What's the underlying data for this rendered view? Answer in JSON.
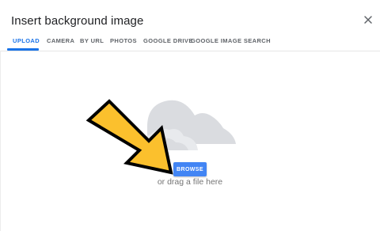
{
  "dialog": {
    "title": "Insert background image",
    "close_icon": "close-icon"
  },
  "tabs": [
    {
      "label": "UPLOAD",
      "active": true
    },
    {
      "label": "CAMERA",
      "active": false
    },
    {
      "label": "BY URL",
      "active": false
    },
    {
      "label": "PHOTOS",
      "active": false
    },
    {
      "label": "GOOGLE DRIVE",
      "active": false
    },
    {
      "label": "GOOGLE IMAGE SEARCH",
      "active": false
    }
  ],
  "upload": {
    "browse_label": "BROWSE",
    "drag_text": "or drag a file here",
    "illustration": "cloud-icon",
    "pointer": "arrow-icon"
  },
  "colors": {
    "accent": "#1a73e8",
    "button": "#4285f4",
    "cloud": "#dadce0",
    "arrow_fill": "#fbc02d",
    "arrow_outline": "#000000"
  }
}
